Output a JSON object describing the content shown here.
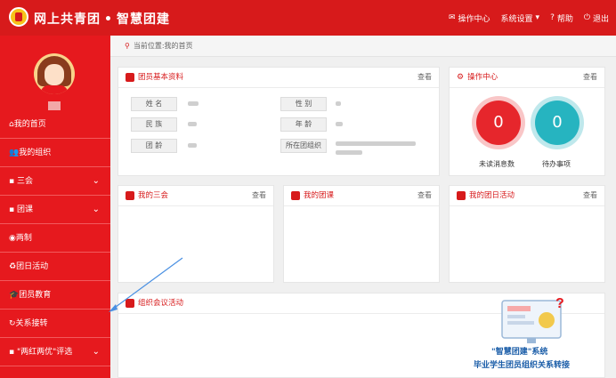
{
  "header": {
    "brand": "网上共青团",
    "brand_sub": "智慧团建",
    "nav": [
      {
        "icon": "mail-icon",
        "label": "操作中心"
      },
      {
        "icon": "settings-icon",
        "label": "系统设置"
      },
      {
        "icon": "help-icon",
        "label": "帮助"
      },
      {
        "icon": "power-icon",
        "label": "退出"
      }
    ]
  },
  "sidebar": {
    "items": [
      {
        "label": "我的首页"
      },
      {
        "label": "我的组织"
      },
      {
        "label": "三会"
      },
      {
        "label": "团课"
      },
      {
        "label": "两制"
      },
      {
        "label": "团日活动"
      },
      {
        "label": "团员教育"
      },
      {
        "label": "关系接转"
      },
      {
        "label": "\"两红两优\"评选"
      }
    ]
  },
  "breadcrumb": "当前位置:我的首页",
  "profile": {
    "title": "团员基本资料",
    "more": "查看",
    "labels": {
      "name": "姓 名",
      "gender": "性 别",
      "ethnicity": "民 族",
      "age": "年 龄",
      "league_age": "团 龄",
      "org": "所在团组织"
    }
  },
  "ops": {
    "title": "操作中心",
    "more": "查看",
    "unread_count": "0",
    "unread_label": "未读消息数",
    "todo_count": "0",
    "todo_label": "待办事项"
  },
  "panels": {
    "sanhui": {
      "title": "我的三会",
      "more": "查看"
    },
    "tuanke": {
      "title": "我的团课",
      "more": "查看"
    },
    "tuanri": {
      "title": "我的团日活动",
      "more": "查看"
    },
    "meeting": {
      "title": "组织会议活动"
    }
  },
  "promo": {
    "line1": "\"智慧团建\"系统",
    "line2": "毕业学生团员组织关系转接"
  },
  "colors": {
    "brand_red": "#d71a1b",
    "sidebar_red": "#e6191e",
    "teal": "#26b4c0",
    "highlight_blue": "#4a90e2"
  }
}
